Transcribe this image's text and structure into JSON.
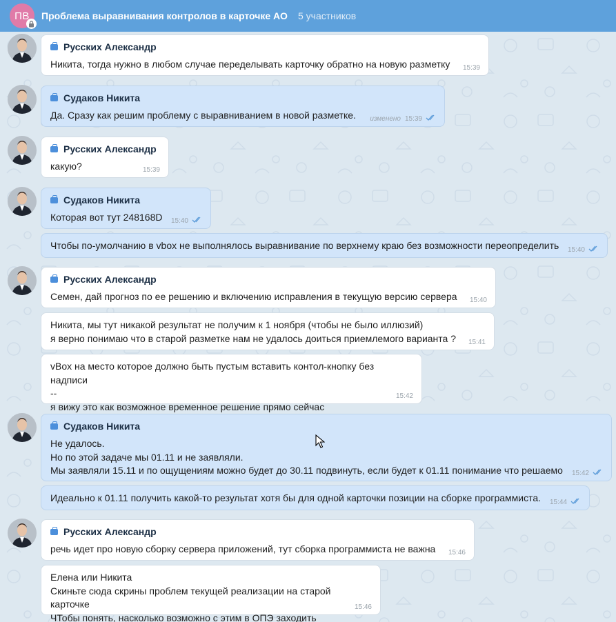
{
  "header": {
    "avatar_initials": "ПВ",
    "title": "Проблема выравнивания контролов в карточке АО",
    "members": "5 участников"
  },
  "colors": {
    "header_bg": "#5ea1dc",
    "incoming_bubble": "#ffffff",
    "outgoing_bubble": "#d2e5fa",
    "accent": "#4c8fdb"
  },
  "messages": [
    {
      "sender": "Русских Александр",
      "text": "Никита, тогда нужно в любом случае переделывать карточку обратно на новую разметку",
      "time": "15:39"
    },
    {
      "sender": "Судаков Никита",
      "text": "Да. Сразу как решим проблему с выравниванием в новой разметке.",
      "edited": "изменено",
      "time": "15:39"
    },
    {
      "sender": "Русских Александр",
      "text": "какую?",
      "time": "15:39"
    },
    {
      "sender": "Судаков Никита",
      "text": "Которая вот тут 248168D",
      "time": "15:40"
    },
    {
      "text": "Чтобы по-умолчанию в vbox не выполнялось выравнивание по верхнему краю без возможности переопределить",
      "time": "15:40"
    },
    {
      "sender": "Русских Александр",
      "text": "Семен, дай прогноз по ее решению и включению исправления в текущую версию сервера",
      "time": "15:40"
    },
    {
      "text": "Никита, мы тут никакой результат не получим к 1 ноября (чтобы не было иллюзий)\nя верно понимаю что в старой разметке нам не удалось доиться приемлемого варианта ?",
      "time": "15:41"
    },
    {
      "text": "vBox на место которое должно быть пустым вставить контол-кнопку без надписи\n--\nя вижу это как возможное временное решение прямо сейчас",
      "time": "15:42"
    },
    {
      "sender": "Судаков Никита",
      "text": "Не удалось.\nНо по этой задаче мы 01.11 и не заявляли.\nМы заявляли 15.11 и по ощущениям можно будет до 30.11 подвинуть, если будет к 01.11 понимание что решаемо",
      "time": "15:42"
    },
    {
      "text": "Идеально к 01.11 получить какой-то результат хотя бы для одной карточки позиции на сборке программиста.",
      "time": "15:44"
    },
    {
      "sender": "Русских Александр",
      "text": "речь идет про новую сборку сервера приложений, тут сборка программиста не важна",
      "time": "15:46"
    },
    {
      "text": "Елена или Никита\nСкиньте сюда скрины проблем текущей реализации на старой карточке\nЧТобы понять, насколько возможно с этим в ОПЭ заходить",
      "time": "15:46"
    }
  ]
}
